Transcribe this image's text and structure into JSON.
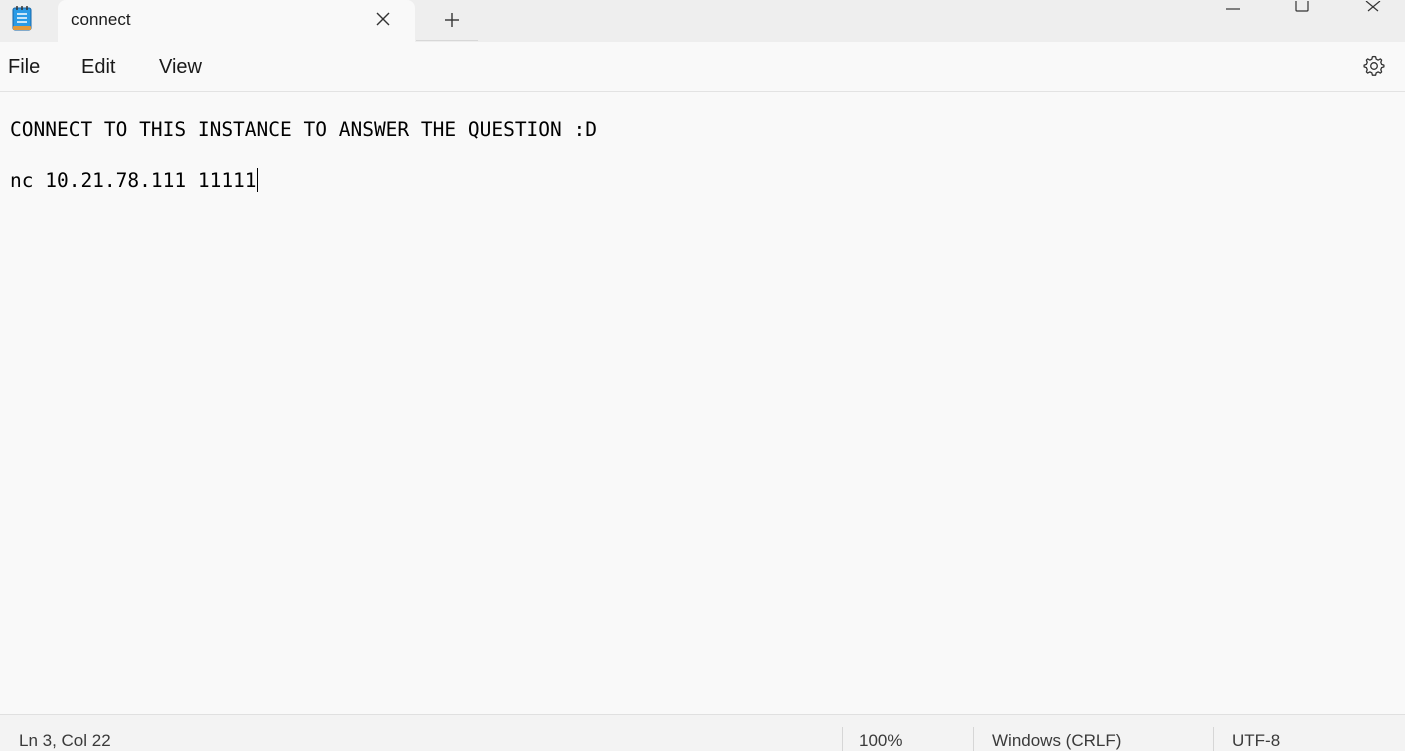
{
  "tab": {
    "title": "connect"
  },
  "menu": {
    "file": "File",
    "edit": "Edit",
    "view": "View"
  },
  "editor": {
    "lines": [
      "CONNECT TO THIS INSTANCE TO ANSWER THE QUESTION :D",
      "",
      "nc 10.21.78.111 11111"
    ]
  },
  "status": {
    "position": "Ln 3, Col 22",
    "zoom": "100%",
    "line_ending": "Windows (CRLF)",
    "encoding": "UTF-8"
  },
  "icons": {
    "app": "notepad-icon",
    "tab_close": "close-icon",
    "new_tab": "plus-icon",
    "minimize": "minimize-icon",
    "maximize": "maximize-icon",
    "window_close": "close-icon",
    "settings": "gear-icon"
  },
  "colors": {
    "app_icon_blue": "#1e88d6",
    "background": "#f9f9f9",
    "tabstrip": "#eeeeee"
  }
}
